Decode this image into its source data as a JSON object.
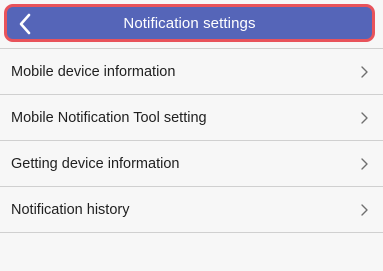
{
  "header": {
    "title": "Notification settings",
    "back_icon": "chevron-left-icon"
  },
  "menu": {
    "items": [
      {
        "label": "Mobile device information",
        "icon": "chevron-right-icon"
      },
      {
        "label": "Mobile Notification Tool setting",
        "icon": "chevron-right-icon"
      },
      {
        "label": "Getting device information",
        "icon": "chevron-right-icon"
      },
      {
        "label": "Notification history",
        "icon": "chevron-right-icon"
      }
    ]
  },
  "colors": {
    "header_bg": "#5565b8",
    "highlight_border": "#e8535b",
    "list_bg": "#f7f7f7",
    "divider": "#d0d0d0"
  }
}
